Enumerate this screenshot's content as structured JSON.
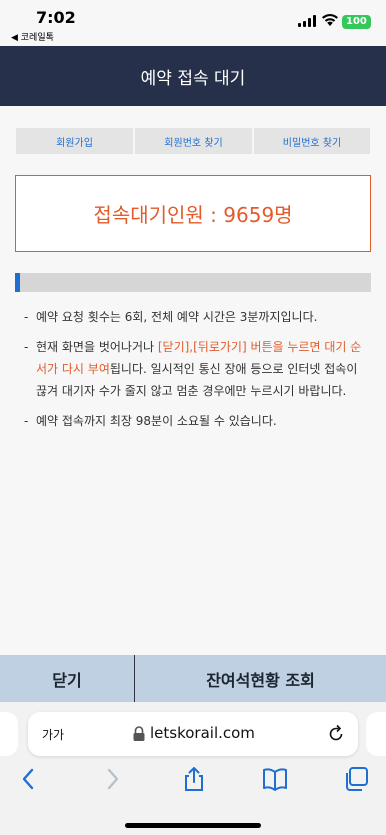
{
  "status_bar": {
    "time": "7:02",
    "back_app": "◀ 코레일톡",
    "battery": "100"
  },
  "header": {
    "title": "예약 접속 대기"
  },
  "nav": [
    "회원가입",
    "회원번호 찾기",
    "비밀번호 찾기"
  ],
  "waiting": {
    "text": "접속대기인원 : 9659명",
    "count": 9659
  },
  "progress": {
    "fraction": 0.015
  },
  "notices": {
    "n1": "예약 요청 횟수는 6회, 전체 예약 시간은 3분까지입니다.",
    "n2_part1": "현재 화면을 벗어나거나 ",
    "n2_highlight": "[닫기],[뒤로가기] 버튼을 누르면 대기 순서가 다시 부여",
    "n2_part2": "됩니다. 일시적인 통신 장애 등으로 인터넷 접속이 끊겨 대기자 수가 줄지 않고 멈춘 경우에만 누르시기 바랍니다.",
    "n3": "예약 접속까지 최장 98분이 소요될 수 있습니다.",
    "dash": "-"
  },
  "bottom": {
    "close": "닫기",
    "seats": "잔여석현황 조회"
  },
  "browser": {
    "aa": "가가",
    "url": "letskorail.com"
  },
  "colors": {
    "header": "#26304a",
    "accent": "#e35b2a",
    "link": "#1e6fd0",
    "bottom_bar": "#bfd0e2"
  },
  "icons": [
    "signal-icon",
    "wifi-icon",
    "lock-icon",
    "reload-icon",
    "back-arrow-icon",
    "forward-arrow-icon",
    "share-icon",
    "bookmarks-icon",
    "tabs-icon"
  ]
}
